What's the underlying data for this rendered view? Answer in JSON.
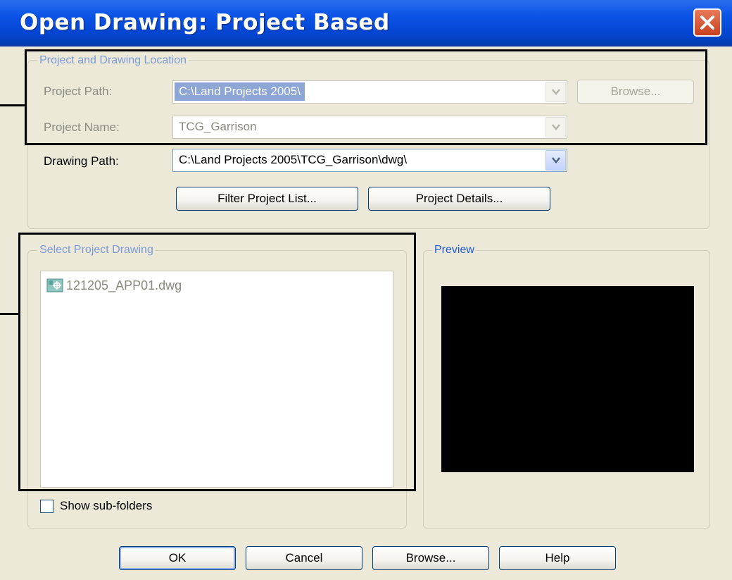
{
  "window": {
    "title": "Open Drawing: Project Based"
  },
  "location_group": {
    "legend": "Project and Drawing Location",
    "project_path_label": "Project Path:",
    "project_path_value": "C:\\Land Projects 2005\\",
    "browse_label": "Browse...",
    "project_name_label": "Project Name:",
    "project_name_value": "TCG_Garrison",
    "drawing_path_label": "Drawing Path:",
    "drawing_path_value": "C:\\Land Projects 2005\\TCG_Garrison\\dwg\\",
    "filter_button": "Filter Project List...",
    "details_button": "Project Details..."
  },
  "select_group": {
    "legend": "Select Project Drawing",
    "files": [
      {
        "name": "121205_APP01.dwg",
        "icon": "dwg-file-icon"
      }
    ],
    "show_subfolders_label": "Show sub-folders",
    "show_subfolders_checked": false
  },
  "preview_group": {
    "legend": "Preview"
  },
  "footer": {
    "ok": "OK",
    "cancel": "Cancel",
    "browse": "Browse...",
    "help": "Help"
  },
  "colors": {
    "titlebar": "#0a53e6",
    "dialog_bg": "#ece9d8",
    "legend_text": "#1c5ad8",
    "close_button": "#d4502c"
  }
}
